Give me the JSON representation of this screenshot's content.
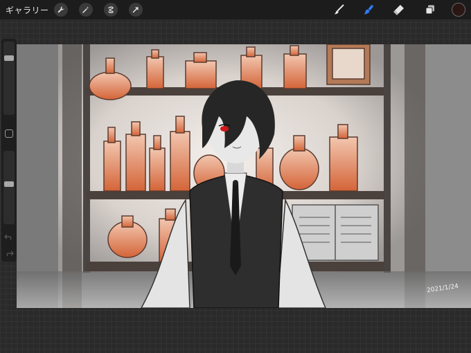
{
  "app": {
    "gallery_label": "ギャラリー"
  },
  "toolbar_left": {
    "icons": [
      "wrench-icon",
      "magic-wand-icon",
      "selection-icon",
      "transform-arrow-icon"
    ]
  },
  "toolbar_right": {
    "icons": [
      "brush-icon",
      "smudge-icon",
      "eraser-icon",
      "layers-icon"
    ],
    "active_tool": "smudge",
    "active_color": "#2a1612",
    "accent_color": "#2f7bf6"
  },
  "sidebar": {
    "brush_size_level": 0.2,
    "opacity_level": 0.45,
    "undo_icon": "undo-arrow-icon",
    "redo_icon": "redo-arrow-icon"
  },
  "artwork": {
    "signature": "2021/1/24"
  }
}
